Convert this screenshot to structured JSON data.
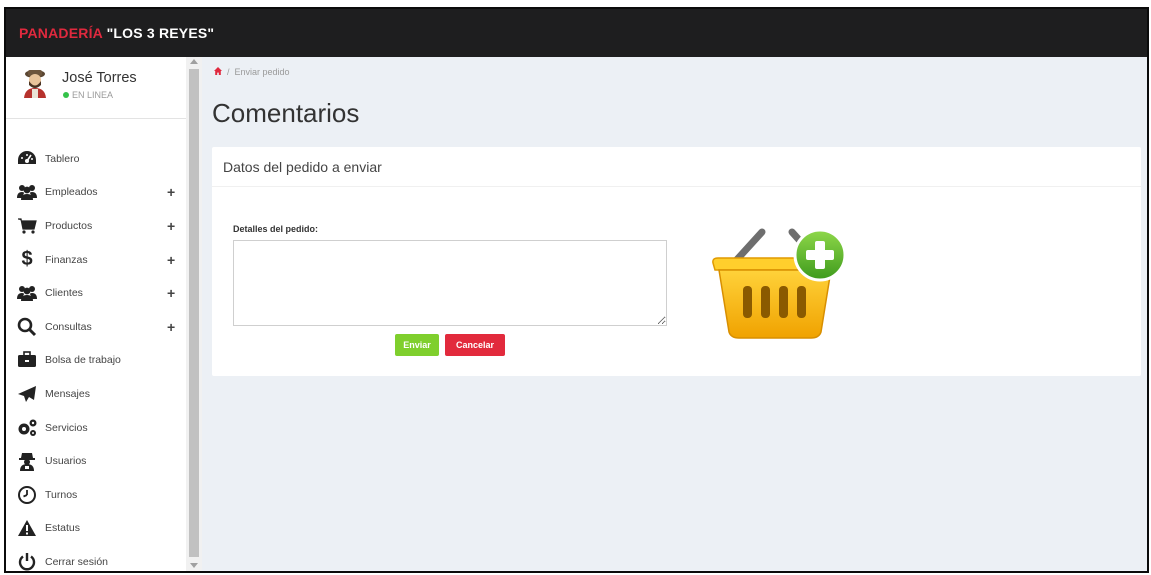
{
  "header": {
    "brand_part1": "PANADERÍA ",
    "brand_part2": "\"LOS 3 REYES\""
  },
  "user": {
    "name": "José Torres",
    "status": "EN LINEA"
  },
  "sidebar": {
    "items": [
      {
        "label": "Tablero",
        "icon": "dashboard-icon",
        "expandable": false
      },
      {
        "label": "Empleados",
        "icon": "users-icon",
        "expandable": true
      },
      {
        "label": "Productos",
        "icon": "cart-icon",
        "expandable": true
      },
      {
        "label": "Finanzas",
        "icon": "dollar-icon",
        "expandable": true
      },
      {
        "label": "Clientes",
        "icon": "users-icon",
        "expandable": true
      },
      {
        "label": "Consultas",
        "icon": "search-icon",
        "expandable": true
      },
      {
        "label": "Bolsa de trabajo",
        "icon": "briefcase-icon",
        "expandable": false
      },
      {
        "label": "Mensajes",
        "icon": "paper-plane-icon",
        "expandable": false
      },
      {
        "label": "Servicios",
        "icon": "gears-icon",
        "expandable": false
      },
      {
        "label": "Usuarios",
        "icon": "user-secret-icon",
        "expandable": false
      },
      {
        "label": "Turnos",
        "icon": "clock-icon",
        "expandable": false
      },
      {
        "label": "Estatus",
        "icon": "warning-icon",
        "expandable": false
      },
      {
        "label": "Cerrar sesión",
        "icon": "power-icon",
        "expandable": false
      }
    ],
    "expand_symbol": "+"
  },
  "breadcrumb": {
    "separator": "/",
    "current": "Enviar pedido"
  },
  "page": {
    "title": "Comentarios"
  },
  "form": {
    "box_title": "Datos del pedido a enviar",
    "field_label": "Detalles del pedido:",
    "textarea_value": "",
    "submit_label": "Enviar",
    "cancel_label": "Cancelar"
  },
  "colors": {
    "brand_red": "#e0293e",
    "topbar": "#1e1e1f",
    "content_bg": "#ecf0f5",
    "btn_green": "#7fcf2d",
    "btn_red": "#e22a3c",
    "status_green": "#35c24a"
  }
}
